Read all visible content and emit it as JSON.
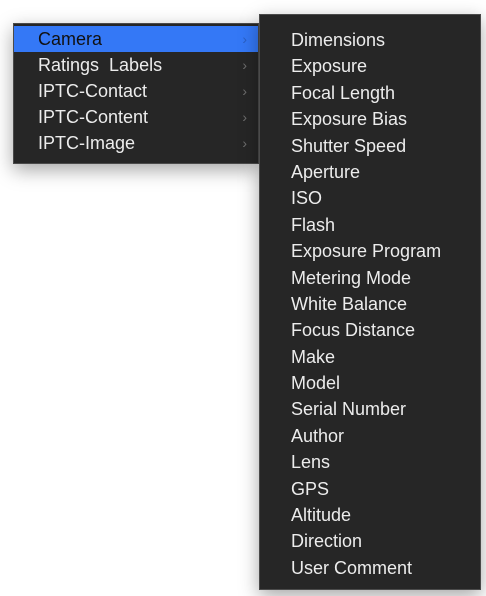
{
  "main_menu": {
    "items": [
      {
        "label": "Camera",
        "icon": "chevron-right-icon",
        "selected": true
      },
      {
        "label": "Ratings  Labels",
        "icon": "chevron-right-icon",
        "selected": false
      },
      {
        "label": "IPTC-Contact",
        "icon": "chevron-right-icon",
        "selected": false
      },
      {
        "label": "IPTC-Content",
        "icon": "chevron-right-icon",
        "selected": false
      },
      {
        "label": "IPTC-Image",
        "icon": "chevron-right-icon",
        "selected": false
      }
    ],
    "chevron_glyph": "›"
  },
  "submenu": {
    "items": [
      "Dimensions",
      "Exposure",
      "Focal Length",
      "Exposure Bias",
      "Shutter Speed",
      "Aperture",
      "ISO",
      "Flash",
      "Exposure Program",
      "Metering Mode",
      "White Balance",
      "Focus Distance",
      "Make",
      "Model",
      "Serial Number",
      "Author",
      "Lens",
      "GPS",
      "Altitude",
      "Direction",
      "User Comment"
    ]
  },
  "colors": {
    "menu_background": "#262626",
    "selection": "#3478f6",
    "text": "#ececec",
    "chevron": "#6e6e6e"
  }
}
